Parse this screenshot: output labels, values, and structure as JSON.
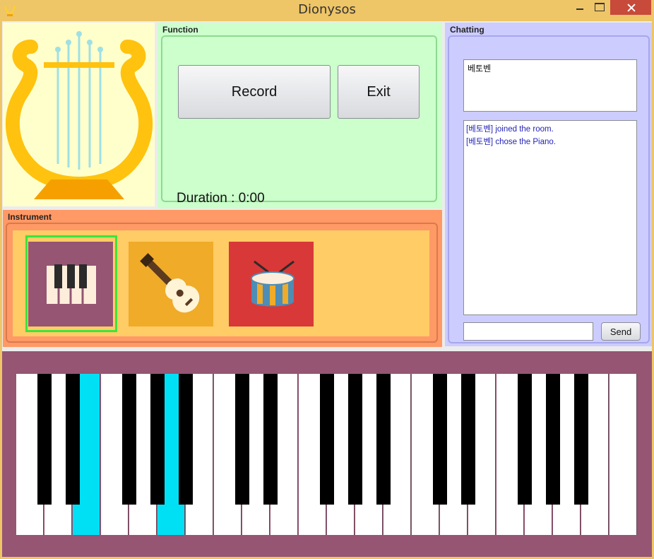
{
  "window": {
    "title": "Dionysos",
    "colors": {
      "frame": "#eec567",
      "close": "#c74a3a"
    }
  },
  "function_panel": {
    "label": "Function",
    "record_label": "Record",
    "exit_label": "Exit",
    "duration_label": "Duration : 0:00"
  },
  "chat_panel": {
    "label": "Chatting",
    "users": [
      "베토벤"
    ],
    "messages": [
      "[베토벤] joined the room.",
      "[베토벤] chose the Piano."
    ],
    "input_value": "",
    "send_label": "Send"
  },
  "instrument_panel": {
    "label": "Instrument",
    "instruments": [
      {
        "name": "piano-icon",
        "selected": true
      },
      {
        "name": "guitar-icon",
        "selected": false
      },
      {
        "name": "drum-icon",
        "selected": false
      }
    ]
  },
  "keyboard": {
    "white_key_count": 22,
    "pressed_white_keys": [
      2,
      5
    ],
    "key_colors": {
      "white": "#ffffff",
      "black": "#000000",
      "pressed": "#00e0f5",
      "background": "#955573"
    }
  }
}
